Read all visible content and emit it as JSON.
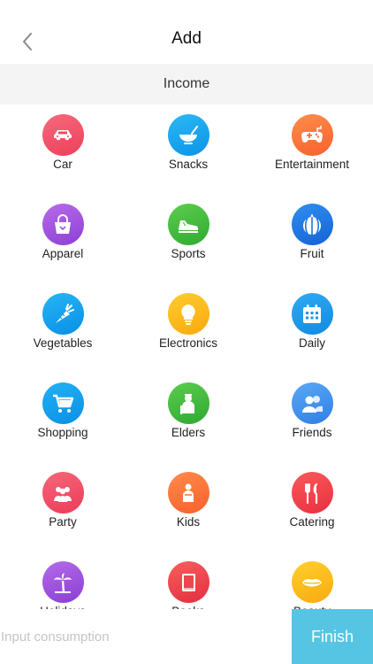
{
  "header": {
    "title": "Add",
    "back_icon": "chevron-left-icon"
  },
  "section": {
    "label": "Income"
  },
  "categories": [
    {
      "label": "Car",
      "icon": "car-icon",
      "gradient": [
        "#f56a7d",
        "#ee3f5a"
      ]
    },
    {
      "label": "Snacks",
      "icon": "bowl-icon",
      "gradient": [
        "#2db8f5",
        "#0a94e6"
      ]
    },
    {
      "label": "Entertainment",
      "icon": "gamepad-icon",
      "gradient": [
        "#ff8e4a",
        "#f8602e"
      ]
    },
    {
      "label": "Apparel",
      "icon": "handbag-icon",
      "gradient": [
        "#b66be8",
        "#8e3fd6"
      ]
    },
    {
      "label": "Sports",
      "icon": "sneaker-icon",
      "gradient": [
        "#5dcd4e",
        "#2faa32"
      ]
    },
    {
      "label": "Fruit",
      "icon": "watermelon-icon",
      "gradient": [
        "#2e8ff0",
        "#1563d4"
      ]
    },
    {
      "label": "Vegetables",
      "icon": "carrot-icon",
      "gradient": [
        "#26b5f5",
        "#0a8fe6"
      ]
    },
    {
      "label": "Electronics",
      "icon": "lightbulb-icon",
      "gradient": [
        "#ffcc2e",
        "#f9a90f"
      ]
    },
    {
      "label": "Daily",
      "icon": "calendar-icon",
      "gradient": [
        "#2eaaf2",
        "#148ae0"
      ]
    },
    {
      "label": "Shopping",
      "icon": "cart-icon",
      "gradient": [
        "#22b2f4",
        "#0a8fe6"
      ]
    },
    {
      "label": "Elders",
      "icon": "elder-icon",
      "gradient": [
        "#5ccd4d",
        "#2ea833"
      ]
    },
    {
      "label": "Friends",
      "icon": "friends-icon",
      "gradient": [
        "#5aa8f5",
        "#2f7fe6"
      ]
    },
    {
      "label": "Party",
      "icon": "party-icon",
      "gradient": [
        "#f5677a",
        "#ec3c58"
      ]
    },
    {
      "label": "Kids",
      "icon": "kids-icon",
      "gradient": [
        "#ff8b4a",
        "#f8602d"
      ]
    },
    {
      "label": "Catering",
      "icon": "cutlery-icon",
      "gradient": [
        "#f95a5a",
        "#e8303f"
      ]
    },
    {
      "label": "Holidays",
      "icon": "palm-tree-icon",
      "gradient": [
        "#b46be8",
        "#8b3ed6"
      ]
    },
    {
      "label": "Books",
      "icon": "book-icon",
      "gradient": [
        "#f85e5e",
        "#e32f3f"
      ]
    },
    {
      "label": "Beauty",
      "icon": "lips-icon",
      "gradient": [
        "#ffcf2d",
        "#f9aa10"
      ]
    }
  ],
  "bottom": {
    "input_placeholder": "Input consumption",
    "finish_label": "Finish"
  },
  "colors": {
    "accent": "#56c5e3",
    "section_bg": "#f4f4f4"
  }
}
